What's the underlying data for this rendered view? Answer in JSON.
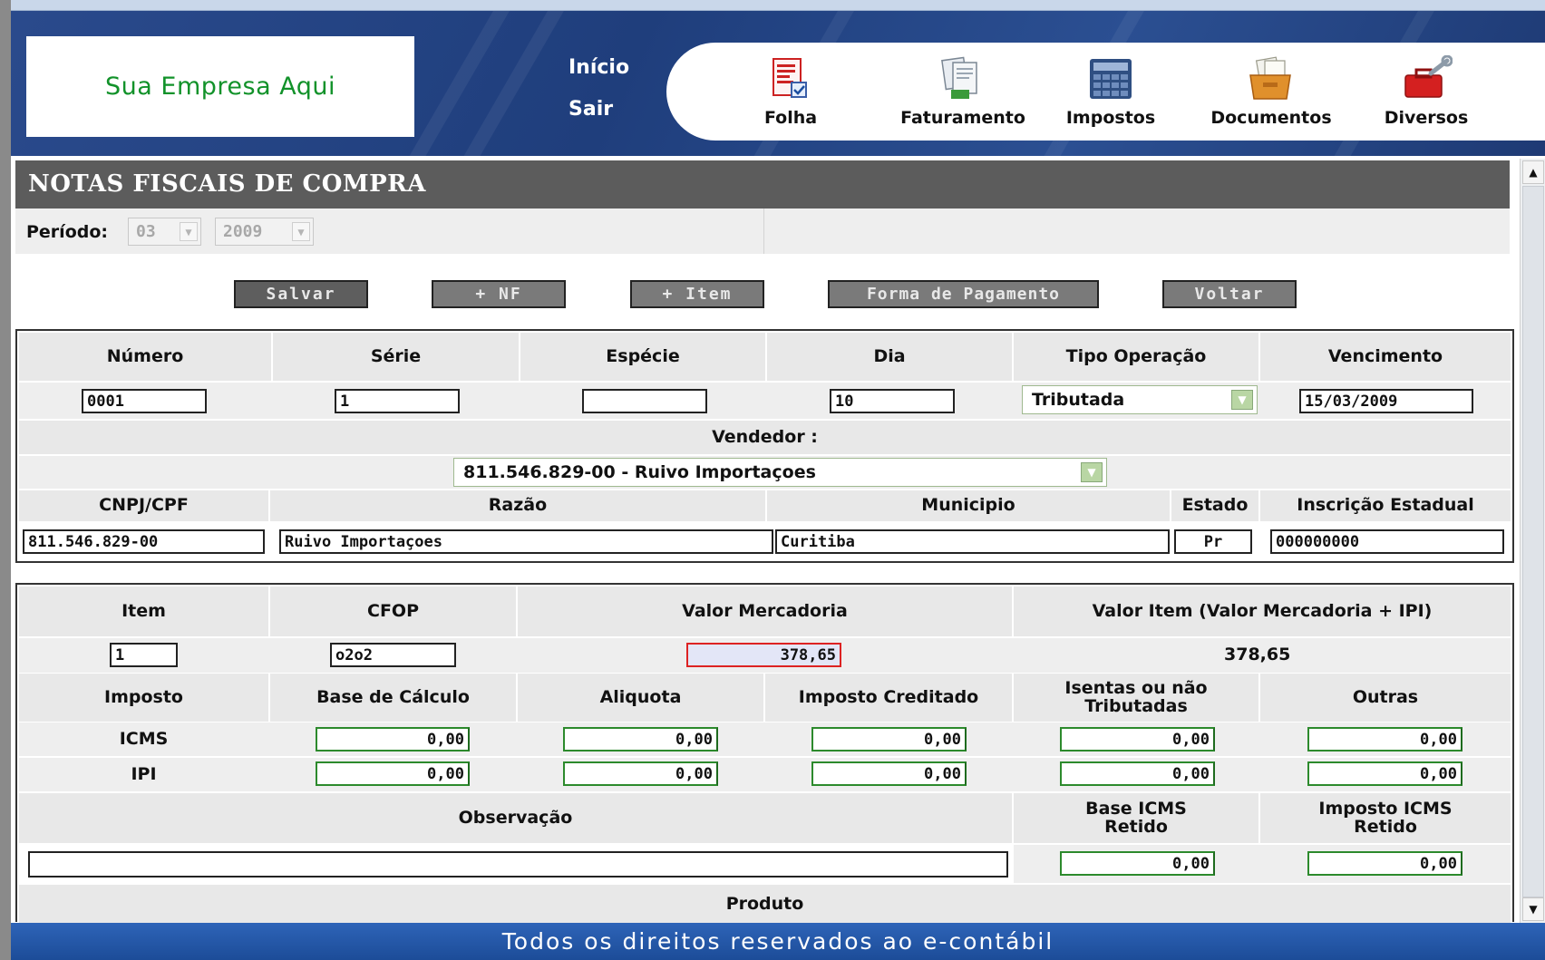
{
  "header": {
    "company": "Sua Empresa Aqui",
    "links": {
      "inicio": "Início",
      "sair": "Sair"
    },
    "menu": [
      {
        "label": "Folha",
        "icon": "payroll-document-icon"
      },
      {
        "label": "Faturamento",
        "icon": "billing-documents-icon"
      },
      {
        "label": "Impostos",
        "icon": "calculator-icon"
      },
      {
        "label": "Documentos",
        "icon": "archive-box-icon"
      },
      {
        "label": "Diversos",
        "icon": "toolbox-icon"
      }
    ]
  },
  "page": {
    "title": "NOTAS FISCAIS DE COMPRA",
    "periodo": {
      "label": "Período:",
      "month": "03",
      "year": "2009"
    }
  },
  "buttons": {
    "salvar": "Salvar",
    "nf": "+ NF",
    "item": "+ Item",
    "forma": "Forma de Pagamento",
    "voltar": "Voltar"
  },
  "nf": {
    "headers": {
      "numero": "Número",
      "serie": "Série",
      "especie": "Espécie",
      "dia": "Dia",
      "tipo": "Tipo Operação",
      "vencimento": "Vencimento"
    },
    "values": {
      "numero": "0001",
      "serie": "1",
      "especie": "",
      "dia": "10",
      "tipo": "Tributada",
      "vencimento": "15/03/2009"
    },
    "vendedor_label": "Vendedor :",
    "vendedor_value": "811.546.829-00 - Ruivo Importaçoes",
    "headers2": {
      "cnpj": "CNPJ/CPF",
      "razao": "Razão",
      "municipio": "Municipio",
      "estado": "Estado",
      "ie": "Inscrição Estadual"
    },
    "values2": {
      "cnpj": "811.546.829-00",
      "razao": "Ruivo Importaçoes",
      "municipio": "Curitiba",
      "estado": "Pr",
      "ie": "000000000"
    }
  },
  "item": {
    "headers": {
      "item": "Item",
      "cfop": "CFOP",
      "valor_merc": "Valor Mercadoria",
      "valor_item": "Valor Item (Valor Mercadoria + IPI)"
    },
    "values": {
      "item": "1",
      "cfop": "o2o2",
      "valor_merc": "378,65",
      "valor_item": "378,65"
    },
    "tax_headers": {
      "imposto": "Imposto",
      "base": "Base de Cálculo",
      "aliquota": "Aliquota",
      "creditado": "Imposto Creditado",
      "isentas": "Isentas ou não Tributadas",
      "outras": "Outras"
    },
    "taxes": [
      {
        "name": "ICMS",
        "base": "0,00",
        "aliquota": "0,00",
        "creditado": "0,00",
        "isentas": "0,00",
        "outras": "0,00"
      },
      {
        "name": "IPI",
        "base": "0,00",
        "aliquota": "0,00",
        "creditado": "0,00",
        "isentas": "0,00",
        "outras": "0,00"
      }
    ],
    "obs_label": "Observação",
    "obs_value": "",
    "base_retido_label": "Base ICMS Retido",
    "imposto_retido_label": "Imposto ICMS Retido",
    "base_retido": "0,00",
    "imposto_retido": "0,00",
    "produto_label": "Produto"
  },
  "footer": "Todos os direitos reservados ao e-contábil",
  "colors": {
    "header_blue": "#1f3e7c",
    "title_gray": "#5c5c5c",
    "logo_green": "#12922a",
    "input_green_border": "#2c8a2c"
  }
}
